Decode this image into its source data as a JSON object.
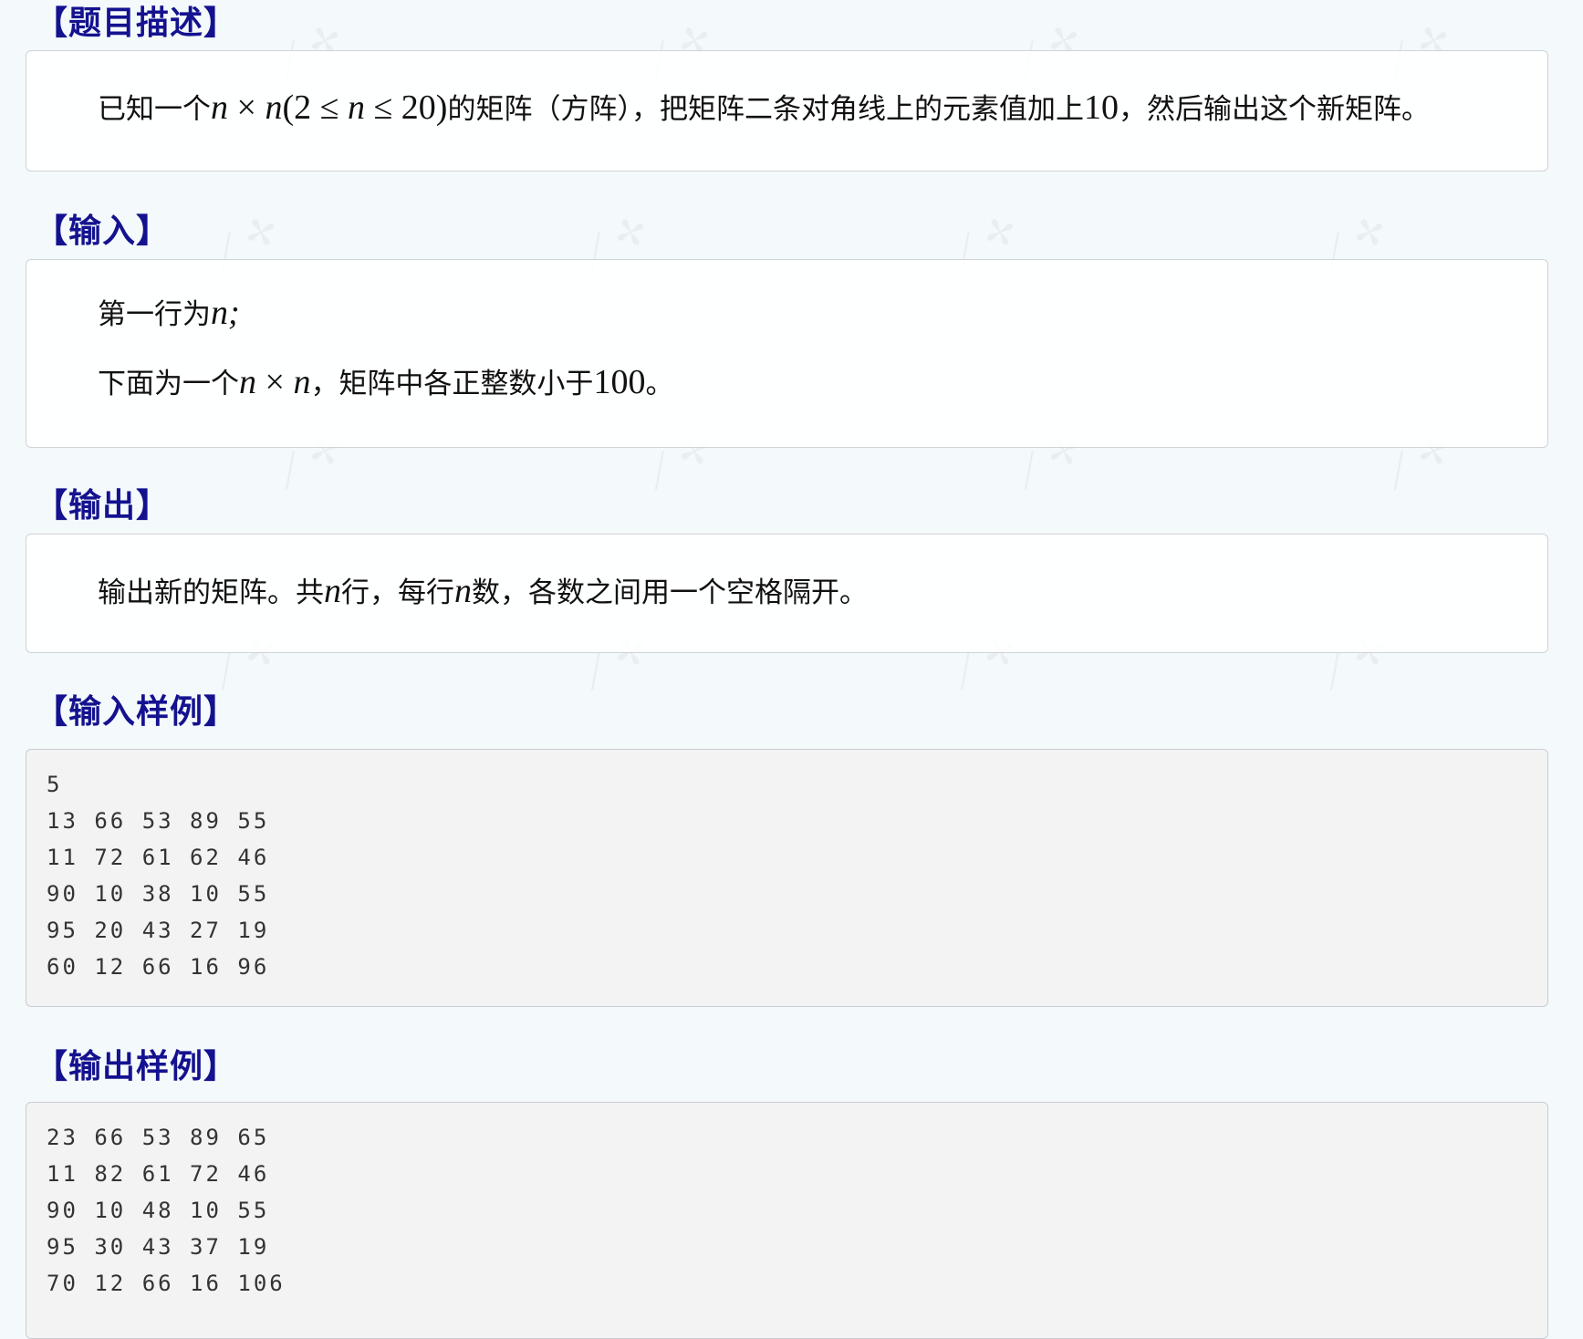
{
  "sections": {
    "description": {
      "title": "【题目描述】",
      "text": {
        "p1": "已知一个",
        "m1": "n",
        "m2": " × ",
        "m3": "n",
        "m4": "(2 ≤ ",
        "m5": "n",
        "m6": " ≤ 20)",
        "p2": "的矩阵（方阵），把矩阵二条对角线上的元素值加上",
        "m7": "10",
        "p3": "，然后输出这个新矩阵。"
      }
    },
    "input": {
      "title": "【输入】",
      "line1": {
        "p1": "第一行为",
        "m1": "n",
        "m2": ";"
      },
      "line2": {
        "p1": "下面为一个",
        "m1": "n",
        "m2": " × ",
        "m3": "n",
        "p2": "，矩阵中各正整数小于",
        "m4": "100",
        "p3": "。"
      }
    },
    "output": {
      "title": "【输出】",
      "text": {
        "p1": "输出新的矩阵。共",
        "m1": "n",
        "p2": "行，每行",
        "m2": "n",
        "p3": "数，各数之间用一个空格隔开。"
      }
    },
    "sample_input": {
      "title": "【输入样例】",
      "lines": [
        "5",
        "13 66 53 89 55",
        "11 72 61 62 46",
        "90 10 38 10 55",
        "95 20 43 27 19",
        "60 12 66 16 96"
      ]
    },
    "sample_output": {
      "title": "【输出样例】",
      "lines": [
        "23 66 53 89 65",
        "11 82 61 72 46",
        "90 10 48 10 55",
        "95 30 43 37 19",
        "70 12 66 16 106"
      ]
    }
  },
  "colors": {
    "heading": "#14128f",
    "page_background": "#f4f9fb",
    "code_background": "#f2f2f2"
  }
}
